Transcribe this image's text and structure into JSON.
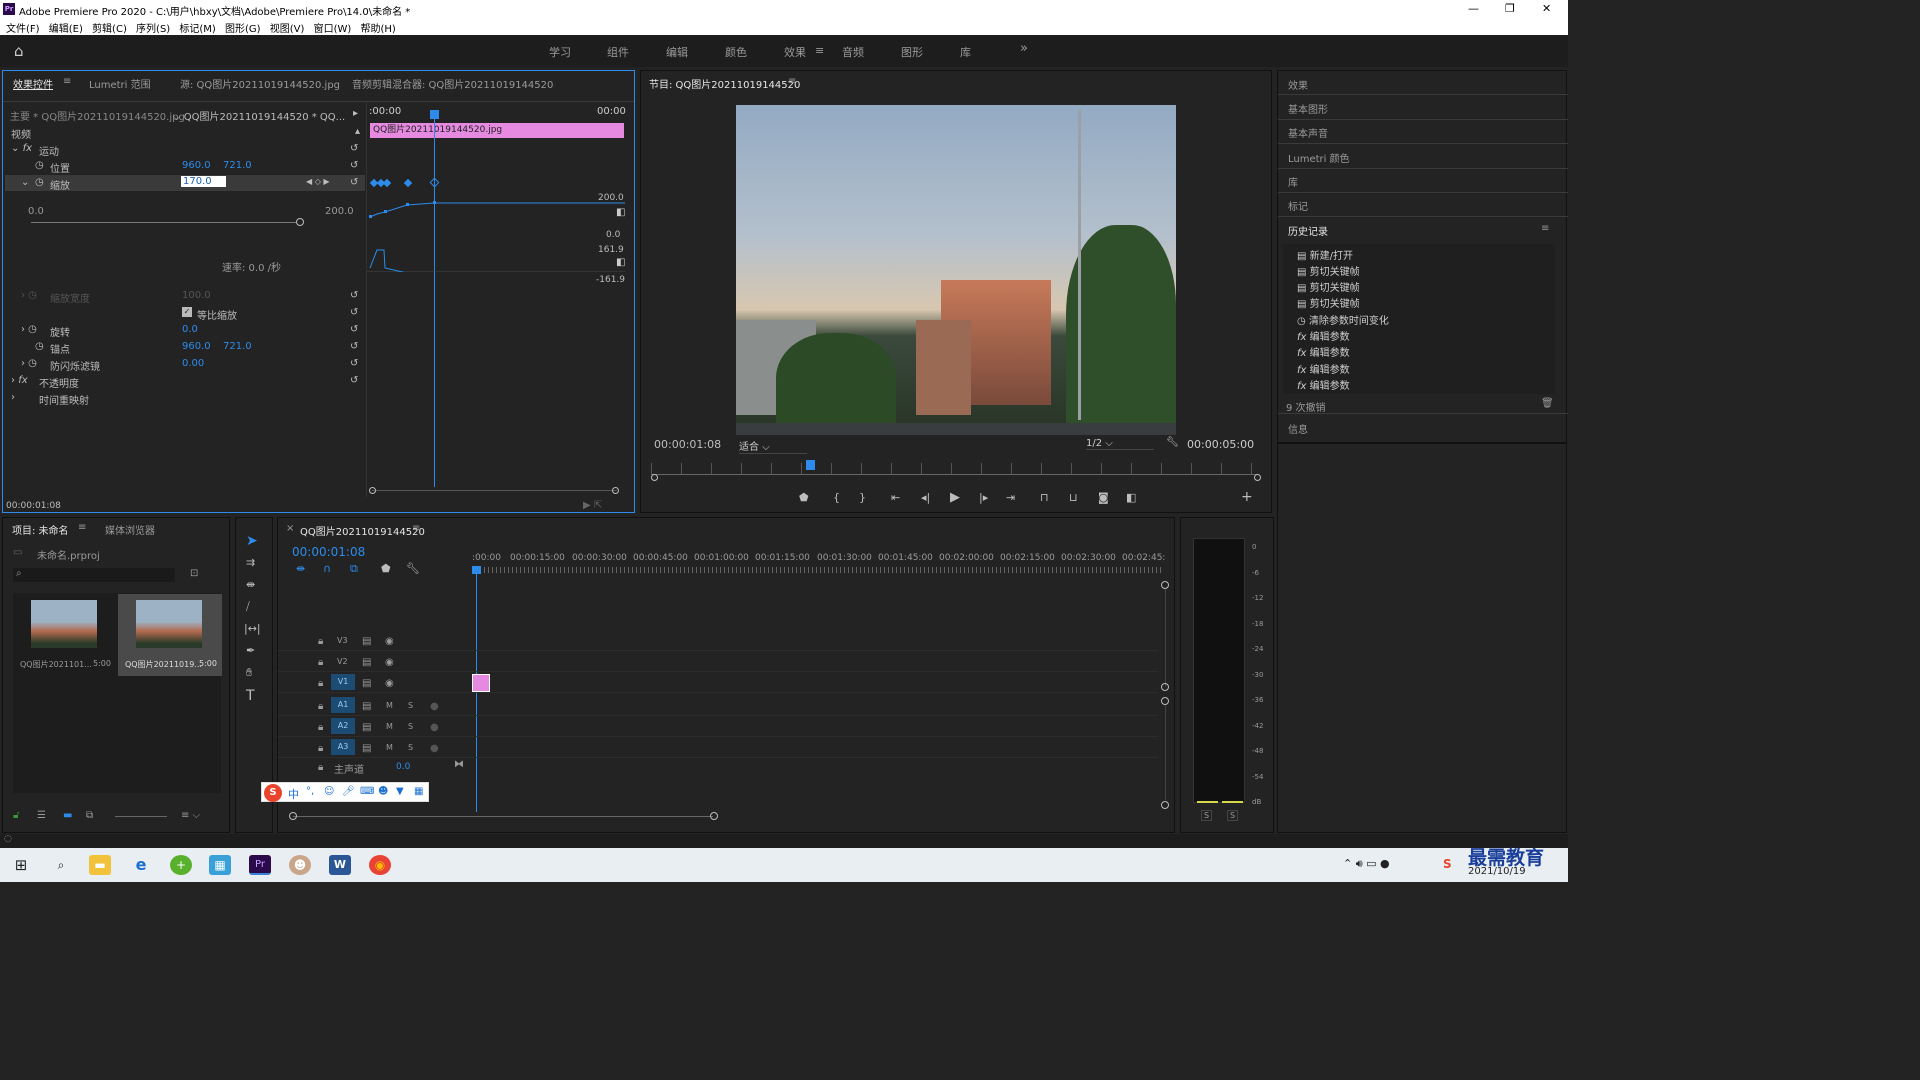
{
  "window": {
    "title": "Adobe Premiere Pro 2020 - C:\\用户\\hbxy\\文档\\Adobe\\Premiere Pro\\14.0\\未命名 *",
    "icon": "Pr"
  },
  "menu": [
    "文件(F)",
    "编辑(E)",
    "剪辑(C)",
    "序列(S)",
    "标记(M)",
    "图形(G)",
    "视图(V)",
    "窗口(W)",
    "帮助(H)"
  ],
  "workspaces": [
    "学习",
    "组件",
    "编辑",
    "颜色",
    "效果",
    "音频",
    "图形",
    "库"
  ],
  "active_workspace": "效果",
  "effect_controls": {
    "tabs": [
      "效果控件",
      "Lumetri 范围",
      "源: QQ图片20211019144520.jpg",
      "音频剪辑混合器: QQ图片20211019144520"
    ],
    "master": "主要 * QQ图片20211019144520.jpg",
    "sequence_clip": "QQ图片20211019144520 * QQ...",
    "time_start": ":00:00",
    "time_end": "00:00",
    "clip_name": "QQ图片20211019144520.jpg",
    "video_label": "视频",
    "motion": "运动",
    "position_label": "位置",
    "position_x": "960.0",
    "position_y": "721.0",
    "scale_label": "缩放",
    "scale_value": "170.0",
    "slider_min": "0.0",
    "slider_max": "200.0",
    "graph_top": "200.0",
    "graph_zero": "0.0",
    "graph_v_top": "161.9",
    "graph_v_bottom": "-161.9",
    "velocity": "速率: 0.0 /秒",
    "scale_width_label": "缩放宽度",
    "scale_width_value": "100.0",
    "uniform_scale": "等比缩放",
    "rotation_label": "旋转",
    "rotation_value": "0.0",
    "anchor_label": "锚点",
    "anchor_x": "960.0",
    "anchor_y": "721.0",
    "flicker_label": "防闪烁滤镜",
    "flicker_value": "0.00",
    "opacity": "不透明度",
    "time_remap": "时间重映射",
    "timecode": "00:00:01:08"
  },
  "program": {
    "title": "节目: QQ图片20211019144520",
    "timecode": "00:00:01:08",
    "fit": "适合",
    "quality": "1/2",
    "duration": "00:00:05:00"
  },
  "right_panels": [
    "效果",
    "基本图形",
    "基本声音",
    "Lumetri 颜色",
    "库",
    "标记"
  ],
  "history": {
    "title": "历史记录",
    "items": [
      {
        "icon": "doc-icon",
        "text": "新建/打开"
      },
      {
        "icon": "doc-icon",
        "text": "剪切关键帧"
      },
      {
        "icon": "doc-icon",
        "text": "剪切关键帧"
      },
      {
        "icon": "doc-icon",
        "text": "剪切关键帧"
      },
      {
        "icon": "stopwatch-icon",
        "text": "清除参数时间变化"
      },
      {
        "icon": "fx-icon",
        "text": "编辑参数"
      },
      {
        "icon": "fx-icon",
        "text": "编辑参数"
      },
      {
        "icon": "fx-icon",
        "text": "编辑参数"
      },
      {
        "icon": "fx-icon",
        "text": "编辑参数"
      }
    ],
    "undo_count": "9 次撤销",
    "info": "信息"
  },
  "project": {
    "tabs": [
      "项目: 未命名",
      "媒体浏览器"
    ],
    "file": "未命名.prproj",
    "items": [
      {
        "name": "QQ图片2021101...",
        "dur": "5:00"
      },
      {
        "name": "QQ图片20211019...",
        "dur": "5:00"
      }
    ]
  },
  "timeline": {
    "tab": "QQ图片20211019144520",
    "timecode": "00:00:01:08",
    "ruler": [
      ":00:00",
      "00:00:15:00",
      "00:00:30:00",
      "00:00:45:00",
      "00:01:00:00",
      "00:01:15:00",
      "00:01:30:00",
      "00:01:45:00",
      "00:02:00:00",
      "00:02:15:00",
      "00:02:30:00",
      "00:02:45:"
    ],
    "video_tracks": [
      "V3",
      "V2",
      "V1"
    ],
    "audio_tracks": [
      "A1",
      "A2",
      "A3"
    ],
    "master_label": "主声道",
    "master_value": "0.0"
  },
  "meter": {
    "scale": [
      "0",
      "-6",
      "-12",
      "-18",
      "-24",
      "-30",
      "-36",
      "-42",
      "-48",
      "-54",
      "dB"
    ],
    "solo": [
      "S",
      "S"
    ]
  },
  "ime": {
    "label": "中"
  },
  "taskbar": {
    "date": "2021/10/19",
    "watermark": "最需教育"
  }
}
